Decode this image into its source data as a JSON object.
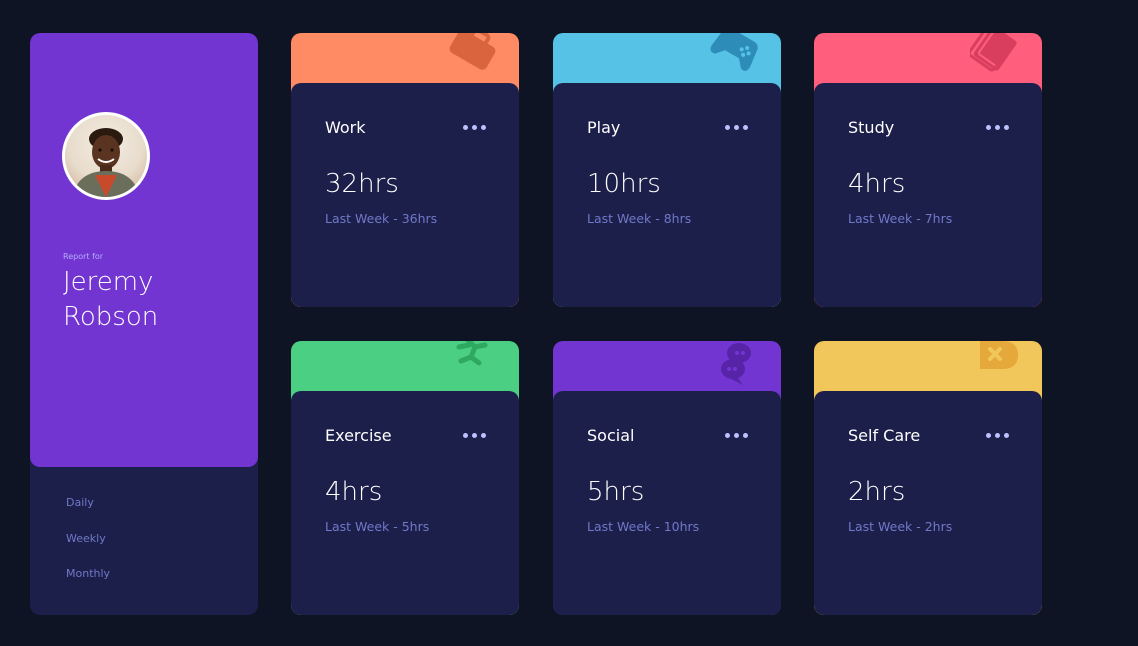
{
  "profile": {
    "report_label": "Report for",
    "name": "Jeremy Robson",
    "avatar": "profile-photo"
  },
  "periods": [
    {
      "label": "Daily"
    },
    {
      "label": "Weekly"
    },
    {
      "label": "Monthly"
    }
  ],
  "colors": {
    "background": "#0f1424",
    "card_body": "#1c1f4a",
    "profile_accent": "#7335d2",
    "muted_text": "#7078c9",
    "work": "#ff8b64",
    "play": "#55c2e6",
    "study": "#ff5e7d",
    "exercise": "#4bcf82",
    "social": "#7335d2",
    "self_care": "#f1c75b"
  },
  "cards": [
    {
      "title": "Work",
      "current": "32hrs",
      "previous": "Last Week - 36hrs",
      "icon": "briefcase-icon",
      "color": "#ff8b64"
    },
    {
      "title": "Play",
      "current": "10hrs",
      "previous": "Last Week - 8hrs",
      "icon": "gamepad-icon",
      "color": "#55c2e6"
    },
    {
      "title": "Study",
      "current": "4hrs",
      "previous": "Last Week - 7hrs",
      "icon": "book-icon",
      "color": "#ff5e7d"
    },
    {
      "title": "Exercise",
      "current": "4hrs",
      "previous": "Last Week - 5hrs",
      "icon": "running-icon",
      "color": "#4bcf82"
    },
    {
      "title": "Social",
      "current": "5hrs",
      "previous": "Last Week - 10hrs",
      "icon": "chat-bubbles-icon",
      "color": "#7335d2"
    },
    {
      "title": "Self Care",
      "current": "2hrs",
      "previous": "Last Week - 2hrs",
      "icon": "self-care-icon",
      "color": "#f1c75b"
    }
  ]
}
